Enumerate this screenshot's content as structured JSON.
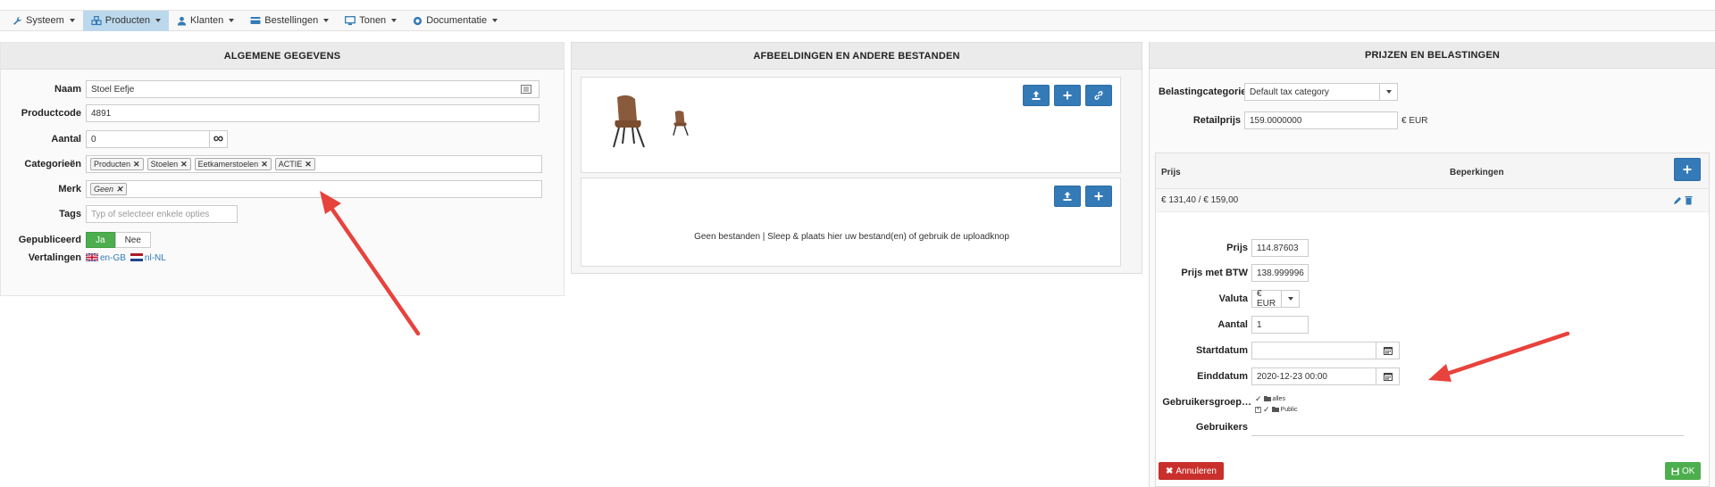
{
  "nav": {
    "items": [
      {
        "label": "Systeem",
        "icon": "wrench-icon"
      },
      {
        "label": "Producten",
        "icon": "cubes-icon"
      },
      {
        "label": "Klanten",
        "icon": "user-icon"
      },
      {
        "label": "Bestellingen",
        "icon": "credit-card-icon"
      },
      {
        "label": "Tonen",
        "icon": "monitor-icon"
      },
      {
        "label": "Documentatie",
        "icon": "lifering-icon"
      }
    ],
    "active": "Producten"
  },
  "general": {
    "title": "ALGEMENE GEGEVENS",
    "name_label": "Naam",
    "name_value": "Stoel Eefje",
    "code_label": "Productcode",
    "code_value": "4891",
    "qty_label": "Aantal",
    "qty_value": "0",
    "qty_infinite": "∞",
    "cat_label": "Categorieën",
    "categories": [
      "Producten",
      "Stoelen",
      "Eetkamerstoelen",
      "ACTIE"
    ],
    "brand_label": "Merk",
    "brand_value": "Geen",
    "tags_label": "Tags",
    "tags_placeholder": "Typ of selecteer enkele opties",
    "pub_label": "Gepubliceerd",
    "pub_yes": "Ja",
    "pub_no": "Nee",
    "trans_label": "Vertalingen",
    "trans_en": "en-GB",
    "trans_nl": "nl-NL"
  },
  "images": {
    "title": "AFBEELDINGEN EN ANDERE BESTANDEN",
    "empty_text": "Geen bestanden | Sleep & plaats hier uw bestand(en) of gebruik de uploadknop"
  },
  "prices": {
    "title": "PRIJZEN EN BELASTINGEN",
    "tax_label": "Belastingcategorie",
    "tax_value": "Default tax category",
    "retail_label": "Retailprijs",
    "retail_value": "159.0000000",
    "retail_currency": "€ EUR",
    "col_price": "Prijs",
    "col_limits": "Beperkingen",
    "row_value": "€ 131,40 / € 159,00",
    "form": {
      "price_label": "Prijs",
      "price_value": "114.87603",
      "price_vat_label": "Prijs met BTW",
      "price_vat_value": "138.999996",
      "currency_label": "Valuta",
      "currency_value": "€ EUR",
      "qty_label": "Aantal",
      "qty_value": "1",
      "start_label": "Startdatum",
      "start_value": "",
      "end_label": "Einddatum",
      "end_value": "2020-12-23 00:00",
      "groups_label": "Gebruikersgroep…",
      "group_alles": "alles",
      "group_public": "Public",
      "users_label": "Gebruikers"
    },
    "cancel_label": "Annuleren",
    "ok_label": "OK"
  },
  "colors": {
    "accent_blue": "#337ab7",
    "success": "#4cae4c",
    "danger": "#c9302c",
    "arrow_red": "#e8423d"
  }
}
